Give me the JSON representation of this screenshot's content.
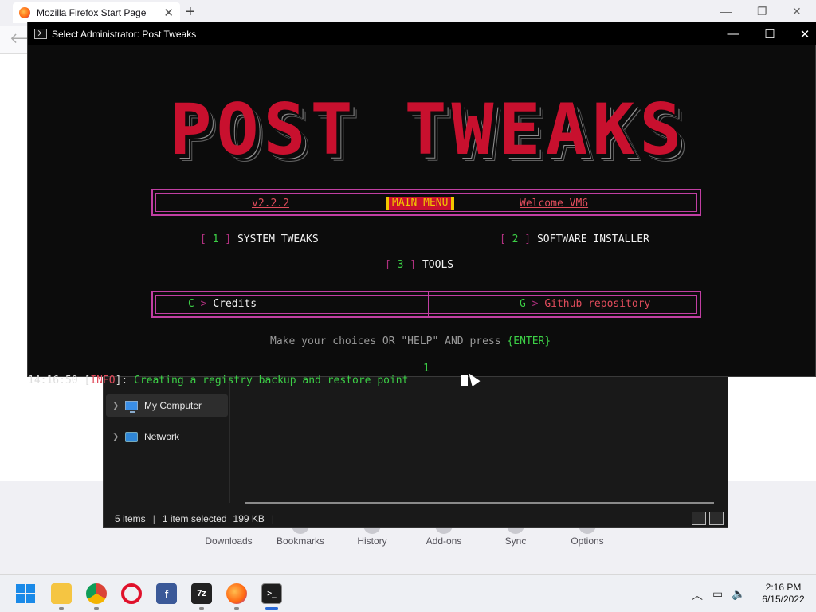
{
  "firefox": {
    "tab_title": "Mozilla Firefox Start Page",
    "toolbar": [
      "Downloads",
      "Bookmarks",
      "History",
      "Add-ons",
      "Sync",
      "Options"
    ]
  },
  "console": {
    "window_title": "Select Administrator:  Post Tweaks",
    "banner": "POST TWEAKS",
    "header": {
      "version": "v2.2.2",
      "main_menu": "MAIN MENU",
      "welcome": "Welcome VM6"
    },
    "options": [
      {
        "key": "1",
        "label": "SYSTEM TWEAKS"
      },
      {
        "key": "2",
        "label": "SOFTWARE INSTALLER"
      },
      {
        "key": "3",
        "label": "TOOLS"
      }
    ],
    "links": [
      {
        "key": "C",
        "label": "Credits"
      },
      {
        "key": "G",
        "label": "Github repository"
      }
    ],
    "prompt": {
      "text": "Make your choices OR \"HELP\" AND press ",
      "enter": "{ENTER}"
    },
    "typed_input": "1",
    "log": {
      "time": "14:16:50",
      "level": "INFO",
      "message": "Creating a registry backup and restore point"
    }
  },
  "explorer": {
    "nav": [
      "My Computer",
      "Network"
    ],
    "status": {
      "items": "5 items",
      "selected": "1 item selected",
      "size": "199 KB"
    }
  },
  "taskbar": {
    "apps": [
      "start",
      "file-explorer",
      "chrome",
      "opera",
      "facebook",
      "7zip",
      "firefox",
      "terminal"
    ],
    "time": "2:16 PM",
    "date": "6/15/2022"
  }
}
